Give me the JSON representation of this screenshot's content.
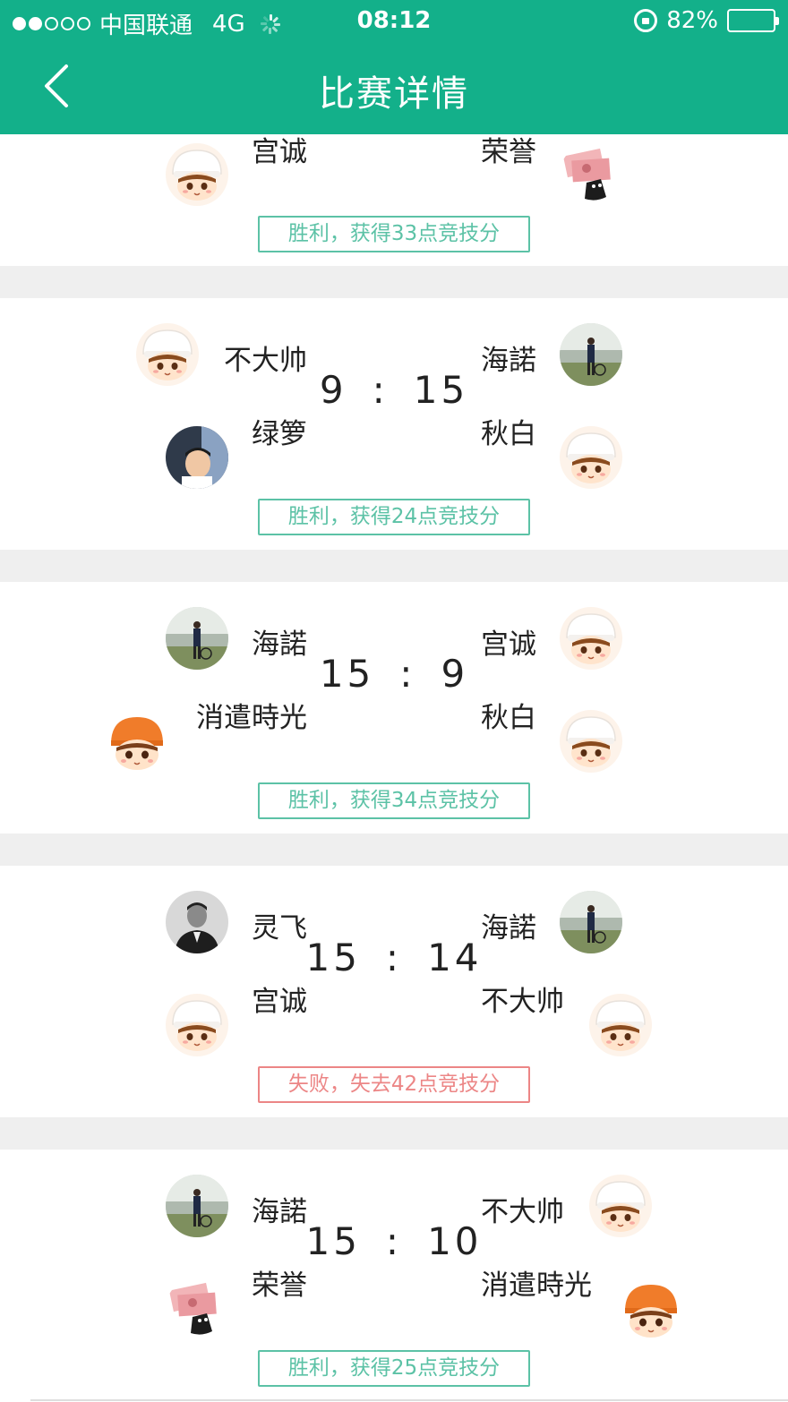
{
  "status_bar": {
    "carrier": "中国联通",
    "network": "4G",
    "time": "08:12",
    "battery": "82%",
    "signal_bars_full": 2,
    "signal_bars_total": 5
  },
  "nav": {
    "title": "比赛详情",
    "back_icon": "chevron-left-icon"
  },
  "colors": {
    "brand": "#13b08a",
    "win": "#5cc2a6",
    "lose": "#ec8686"
  },
  "matches": [
    {
      "team_left": [
        "宫诚"
      ],
      "team_right": [
        "荣誉"
      ],
      "score": "",
      "result": "胜利，获得33点竞技分",
      "outcome": "win"
    },
    {
      "team_left": [
        "不大帅",
        "绿箩"
      ],
      "team_right": [
        "海諾",
        "秋白"
      ],
      "score_left": "9",
      "score_right": "15",
      "score_sep": ":",
      "result": "胜利，获得24点竞技分",
      "outcome": "win"
    },
    {
      "team_left": [
        "海諾",
        "消遣時光"
      ],
      "team_right": [
        "宫诚",
        "秋白"
      ],
      "score_left": "15",
      "score_right": "9",
      "score_sep": ":",
      "result": "胜利，获得34点竞技分",
      "outcome": "win"
    },
    {
      "team_left": [
        "灵飞",
        "宫诚"
      ],
      "team_right": [
        "海諾",
        "不大帅"
      ],
      "score_left": "15",
      "score_right": "14",
      "score_sep": ":",
      "result": "失败，失去42点竞技分",
      "outcome": "lose"
    },
    {
      "team_left": [
        "海諾",
        "荣誉"
      ],
      "team_right": [
        "不大帅",
        "消遣時光"
      ],
      "score_left": "15",
      "score_right": "10",
      "score_sep": ":",
      "result": "胜利，获得25点竞技分",
      "outcome": "win"
    }
  ]
}
